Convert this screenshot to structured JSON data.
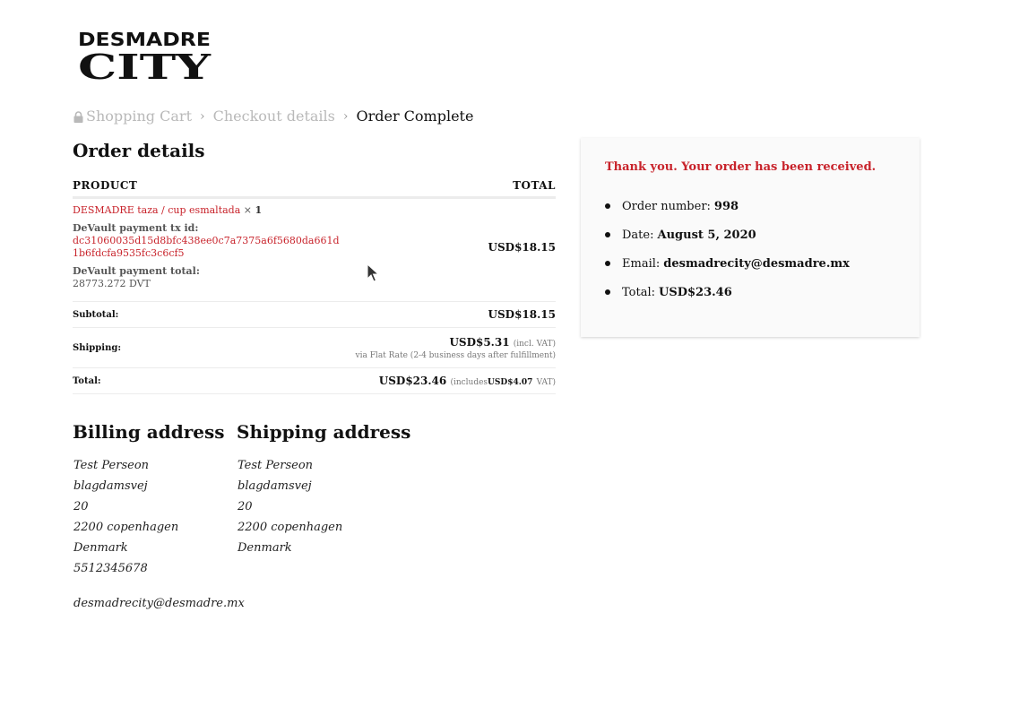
{
  "site": {
    "logo_text_line1": "DESMADRE",
    "logo_text_line2": "CITY"
  },
  "breadcrumb": {
    "step1": "Shopping Cart",
    "step2": "Checkout details",
    "step3": "Order Complete"
  },
  "order_details": {
    "title": "Order details",
    "col_product": "PRODUCT",
    "col_total": "TOTAL",
    "item": {
      "name": "DESMADRE taza / cup esmaltada",
      "qty_sep": "×",
      "qty": "1",
      "tx_label": "DeVault payment tx id:",
      "tx_value": "dc31060035d15d8bfc438ee0c7a7375a6f5680da661d1b6fdcfa9535fc3c6cf5",
      "payment_total_label": "DeVault payment total:",
      "payment_total_value": "28773.272 DVT",
      "total": "USD$18.15"
    },
    "subtotal_label": "Subtotal:",
    "subtotal_value": "USD$18.15",
    "shipping_label": "Shipping:",
    "shipping_value": "USD$5.31",
    "shipping_incl": "(incl. VAT)",
    "shipping_method": "via Flat Rate (2-4 business days after fulfillment)",
    "total_label": "Total:",
    "total_value": "USD$23.46",
    "total_includes": "(includes",
    "total_vat_value": "USD$4.07",
    "total_vat_suffix": "VAT)"
  },
  "billing": {
    "title": "Billing address",
    "name": "Test Perseon",
    "street": "blagdamsvej",
    "number": "20",
    "city": "2200 copenhagen",
    "country": "Denmark",
    "phone": "5512345678",
    "email": "desmadrecity@desmadre.mx"
  },
  "shipping": {
    "title": "Shipping address",
    "name": "Test Perseon",
    "street": "blagdamsvej",
    "number": "20",
    "city": "2200 copenhagen",
    "country": "Denmark"
  },
  "thank_you": {
    "message": "Thank you. Your order has been received.",
    "order_number_label": "Order number:",
    "order_number": "998",
    "date_label": "Date:",
    "date": "August 5, 2020",
    "email_label": "Email:",
    "email": "desmadrecity@desmadre.mx",
    "total_label": "Total:",
    "total": "USD$23.46"
  },
  "colors": {
    "accent": "#c8232b",
    "muted": "#b9b9b9"
  }
}
